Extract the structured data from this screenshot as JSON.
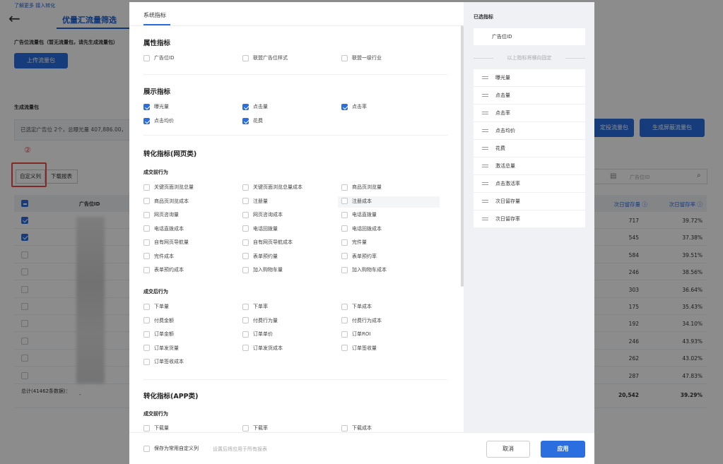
{
  "page": {
    "top_note": "了解更多  接入转化",
    "back_icon": "arrow-left-icon",
    "title": "优量汇流量筛选",
    "package_label": "广告位流量包（暂无流量包，请先生成流量包）",
    "upload_button": "上传流量包",
    "gen_label": "生成流量包",
    "selection_summary": "已选定广告位 2个，总曝光量 407,886.00，",
    "circle_number": "②",
    "custom_columns_button": "自定义列",
    "download_report_button": "下载报表",
    "add_package_button": "定投流量包",
    "gen_block_button": "生成屏蔽流量包",
    "search_placeholder": "广告位ID",
    "calendar_icon": "calendar-icon",
    "search_icon": "search-icon"
  },
  "table": {
    "col_id": "广告位ID",
    "col_retain": "次日留存量 ⓘ",
    "col_retain_rate": "次日留存率 ⓘ",
    "rows": [
      {
        "checked": true,
        "retain": "717",
        "rate": "39.72%"
      },
      {
        "checked": true,
        "retain": "545",
        "rate": "37.38%"
      },
      {
        "checked": false,
        "retain": "584",
        "rate": "39.51%"
      },
      {
        "checked": false,
        "retain": "246",
        "rate": "38.56%"
      },
      {
        "checked": false,
        "retain": "303",
        "rate": "36.64%"
      },
      {
        "checked": false,
        "retain": "175",
        "rate": "35.43%"
      },
      {
        "checked": false,
        "retain": "192",
        "rate": "34.10%"
      },
      {
        "checked": false,
        "retain": "246",
        "rate": "43.93%"
      },
      {
        "checked": false,
        "retain": "262",
        "rate": "43.02%"
      },
      {
        "checked": false,
        "retain": "287",
        "rate": "47.83%"
      }
    ],
    "total_label": "总计(41462条数据)：",
    "total_id": "-",
    "total_retain": "20,542",
    "total_rate": "39.29%"
  },
  "modal": {
    "tab": "系统指标",
    "attr": {
      "title": "属性指标",
      "items": [
        {
          "label": "广告位ID",
          "checked": false
        },
        {
          "label": "联盟广告位样式",
          "checked": false
        },
        {
          "label": "联盟一级行业",
          "checked": false
        }
      ]
    },
    "display": {
      "title": "展示指标",
      "items": [
        {
          "label": "曝光量",
          "checked": true
        },
        {
          "label": "点击量",
          "checked": true
        },
        {
          "label": "点击率",
          "checked": true
        },
        {
          "label": "点击均价",
          "checked": true
        },
        {
          "label": "花费",
          "checked": true
        }
      ]
    },
    "web": {
      "title": "转化指标(网页类)",
      "pre_title": "成交前行为",
      "pre_items": [
        "关键页面浏览总量",
        "关键页面浏览总量成本",
        "商品页浏览量",
        "商品页浏览成本",
        "注册量",
        "注册成本",
        "网页咨询量",
        "网页咨询成本",
        "电话直拨量",
        "电话直拨成本",
        "电话回拨量",
        "电话回拨成本",
        "自有网页导航量",
        "自有网页导航成本",
        "完件量",
        "完件成本",
        "表单预约量",
        "表单预约率",
        "表单预约成本",
        "加入购物车量",
        "加入购物车成本"
      ],
      "post_title": "成交后行为",
      "post_items": [
        "下单量",
        "下单率",
        "下单成本",
        "付费金额",
        "付费行为量",
        "付费行为成本",
        "订单金额",
        "订单单价",
        "订单ROI",
        "订单发货量",
        "订单发货成本",
        "订单签收量",
        "订单签收成本"
      ]
    },
    "app": {
      "title": "转化指标(APP类)",
      "pre_title": "成交前行为",
      "items": [
        "下载量",
        "下载率",
        "下载成本"
      ]
    },
    "selected_title": "已选指标",
    "fixed_item": "广告位ID",
    "fixed_note": "以上指标将横向固定",
    "selected": [
      "曝光量",
      "点击量",
      "点击率",
      "点击均价",
      "花费",
      "激活总量",
      "点击激活率",
      "次日留存量",
      "次日留存率"
    ],
    "save_label": "保存为常用自定义列",
    "save_hint": "设置后将应用于所有报表",
    "cancel": "取消",
    "apply": "应用"
  }
}
